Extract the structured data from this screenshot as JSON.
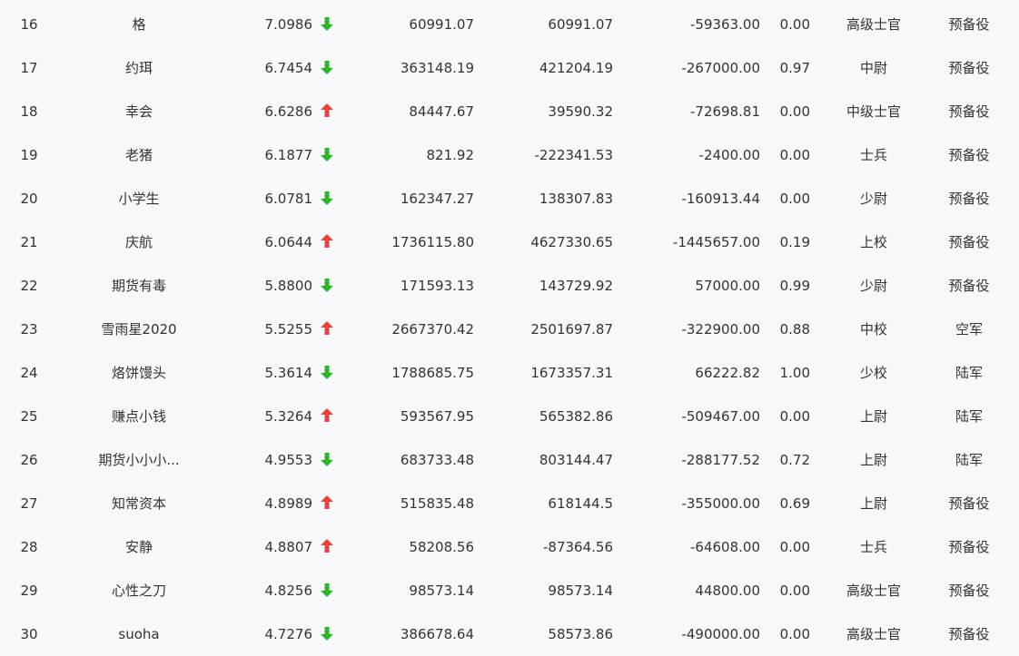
{
  "colors": {
    "up": "#e64340",
    "down": "#2bb52b",
    "text": "#333333",
    "background": "#f7f8fa"
  },
  "icons": {
    "up": "arrow-up-icon",
    "down": "arrow-down-icon"
  },
  "rows": [
    {
      "rank": "16",
      "name": "格",
      "score": "7.0986",
      "trend": "down",
      "v1": "60991.07",
      "v2": "60991.07",
      "v3": "-59363.00",
      "ratio": "0.00",
      "rank_title": "高级士官",
      "branch": "预备役"
    },
    {
      "rank": "17",
      "name": "约珥",
      "score": "6.7454",
      "trend": "down",
      "v1": "363148.19",
      "v2": "421204.19",
      "v3": "-267000.00",
      "ratio": "0.97",
      "rank_title": "中尉",
      "branch": "预备役"
    },
    {
      "rank": "18",
      "name": "幸会",
      "score": "6.6286",
      "trend": "up",
      "v1": "84447.67",
      "v2": "39590.32",
      "v3": "-72698.81",
      "ratio": "0.00",
      "rank_title": "中级士官",
      "branch": "预备役"
    },
    {
      "rank": "19",
      "name": "老猪",
      "score": "6.1877",
      "trend": "down",
      "v1": "821.92",
      "v2": "-222341.53",
      "v3": "-2400.00",
      "ratio": "0.00",
      "rank_title": "士兵",
      "branch": "预备役"
    },
    {
      "rank": "20",
      "name": "小学生",
      "score": "6.0781",
      "trend": "down",
      "v1": "162347.27",
      "v2": "138307.83",
      "v3": "-160913.44",
      "ratio": "0.00",
      "rank_title": "少尉",
      "branch": "预备役"
    },
    {
      "rank": "21",
      "name": "庆航",
      "score": "6.0644",
      "trend": "up",
      "v1": "1736115.80",
      "v2": "4627330.65",
      "v3": "-1445657.00",
      "ratio": "0.19",
      "rank_title": "上校",
      "branch": "预备役"
    },
    {
      "rank": "22",
      "name": "期货有毒",
      "score": "5.8800",
      "trend": "down",
      "v1": "171593.13",
      "v2": "143729.92",
      "v3": "57000.00",
      "ratio": "0.99",
      "rank_title": "少尉",
      "branch": "预备役"
    },
    {
      "rank": "23",
      "name": "雪雨星2020",
      "score": "5.5255",
      "trend": "up",
      "v1": "2667370.42",
      "v2": "2501697.87",
      "v3": "-322900.00",
      "ratio": "0.88",
      "rank_title": "中校",
      "branch": "空军"
    },
    {
      "rank": "24",
      "name": "烙饼馒头",
      "score": "5.3614",
      "trend": "down",
      "v1": "1788685.75",
      "v2": "1673357.31",
      "v3": "66222.82",
      "ratio": "1.00",
      "rank_title": "少校",
      "branch": "陆军"
    },
    {
      "rank": "25",
      "name": "赚点小钱",
      "score": "5.3264",
      "trend": "up",
      "v1": "593567.95",
      "v2": "565382.86",
      "v3": "-509467.00",
      "ratio": "0.00",
      "rank_title": "上尉",
      "branch": "陆军"
    },
    {
      "rank": "26",
      "name": "期货小小小...",
      "score": "4.9553",
      "trend": "down",
      "v1": "683733.48",
      "v2": "803144.47",
      "v3": "-288177.52",
      "ratio": "0.72",
      "rank_title": "上尉",
      "branch": "陆军"
    },
    {
      "rank": "27",
      "name": "知常资本",
      "score": "4.8989",
      "trend": "up",
      "v1": "515835.48",
      "v2": "618144.5",
      "v3": "-355000.00",
      "ratio": "0.69",
      "rank_title": "上尉",
      "branch": "预备役"
    },
    {
      "rank": "28",
      "name": "安静",
      "score": "4.8807",
      "trend": "up",
      "v1": "58208.56",
      "v2": "-87364.56",
      "v3": "-64608.00",
      "ratio": "0.00",
      "rank_title": "士兵",
      "branch": "预备役"
    },
    {
      "rank": "29",
      "name": "心性之刀",
      "score": "4.8256",
      "trend": "down",
      "v1": "98573.14",
      "v2": "98573.14",
      "v3": "44800.00",
      "ratio": "0.00",
      "rank_title": "高级士官",
      "branch": "预备役"
    },
    {
      "rank": "30",
      "name": "suoha",
      "score": "4.7276",
      "trend": "down",
      "v1": "386678.64",
      "v2": "58573.86",
      "v3": "-490000.00",
      "ratio": "0.00",
      "rank_title": "高级士官",
      "branch": "预备役"
    }
  ]
}
